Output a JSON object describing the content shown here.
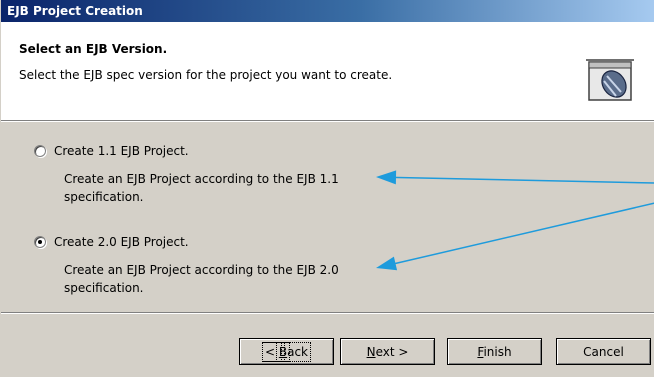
{
  "window": {
    "title": "EJB Project Creation"
  },
  "header": {
    "title": "Select an EJB Version.",
    "description": "Select the EJB spec version for the project you want to create.",
    "icon": "ejb-jar-icon"
  },
  "options": [
    {
      "label": "Create 1.1 EJB Project.",
      "selected": false,
      "desc_line1": "Create an EJB Project according to the EJB 1.1",
      "desc_line2": "specification."
    },
    {
      "label": "Create 2.0 EJB Project.",
      "selected": true,
      "desc_line1": "Create an EJB Project according to the EJB 2.0",
      "desc_line2": "specification."
    }
  ],
  "buttons": {
    "back": {
      "pre": "",
      "key": "B",
      "post": "ack",
      "prefix": "< "
    },
    "next": {
      "pre": "",
      "key": "N",
      "post": "ext >"
    },
    "finish": {
      "pre": "",
      "key": "F",
      "post": "inish"
    },
    "cancel": {
      "label": "Cancel"
    }
  },
  "annotation_color": "#1e9bdc"
}
